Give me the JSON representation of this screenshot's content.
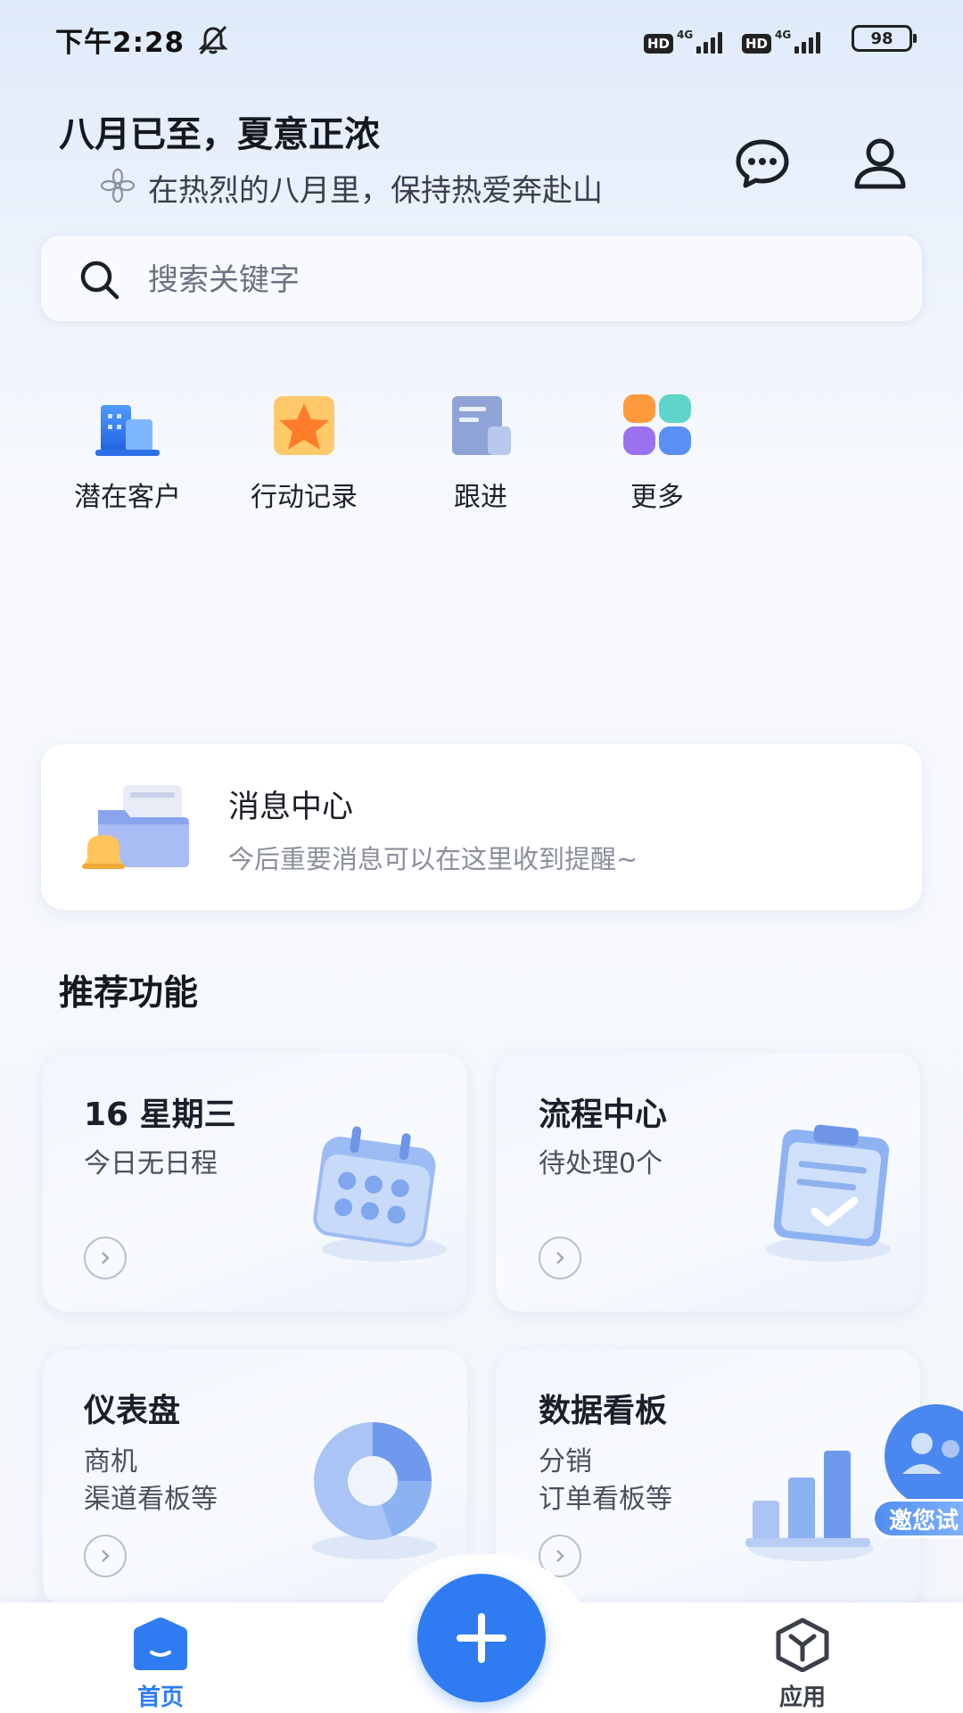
{
  "status_bar": {
    "time": "下午2:28",
    "sim1_badge": "HD",
    "sim1_network": "4G",
    "sim2_badge": "HD",
    "sim2_network": "4G",
    "battery": "98"
  },
  "header": {
    "title": "八月已至，夏意正浓",
    "subtitle": "在热烈的八月里，保持热爱奔赴山"
  },
  "search": {
    "placeholder": "搜索关键字"
  },
  "quick_actions": [
    {
      "label": "潜在客户",
      "icon": "building-icon"
    },
    {
      "label": "行动记录",
      "icon": "star-icon"
    },
    {
      "label": "跟进",
      "icon": "document-icon"
    },
    {
      "label": "更多",
      "icon": "grid-apps-icon"
    }
  ],
  "message_center": {
    "title": "消息中心",
    "subtitle": "今后重要消息可以在这里收到提醒~"
  },
  "recommended": {
    "section_title": "推荐功能",
    "cards": [
      {
        "title": "16 星期三",
        "lines": [
          "今日无日程"
        ],
        "icon": "calendar-icon"
      },
      {
        "title": "流程中心",
        "lines": [
          "待处理0个"
        ],
        "icon": "clipboard-check-icon"
      },
      {
        "title": "仪表盘",
        "lines": [
          "商机",
          "渠道看板等"
        ],
        "icon": "donut-chart-icon"
      },
      {
        "title": "数据看板",
        "lines": [
          "分销",
          "订单看板等"
        ],
        "icon": "bar-chart-icon"
      }
    ]
  },
  "invite": {
    "label": "邀您试"
  },
  "bottom_nav": {
    "home_label": "首页",
    "apps_label": "应用"
  },
  "colors": {
    "accent": "#2f7cf2",
    "background_top": "#dfeaf9"
  }
}
